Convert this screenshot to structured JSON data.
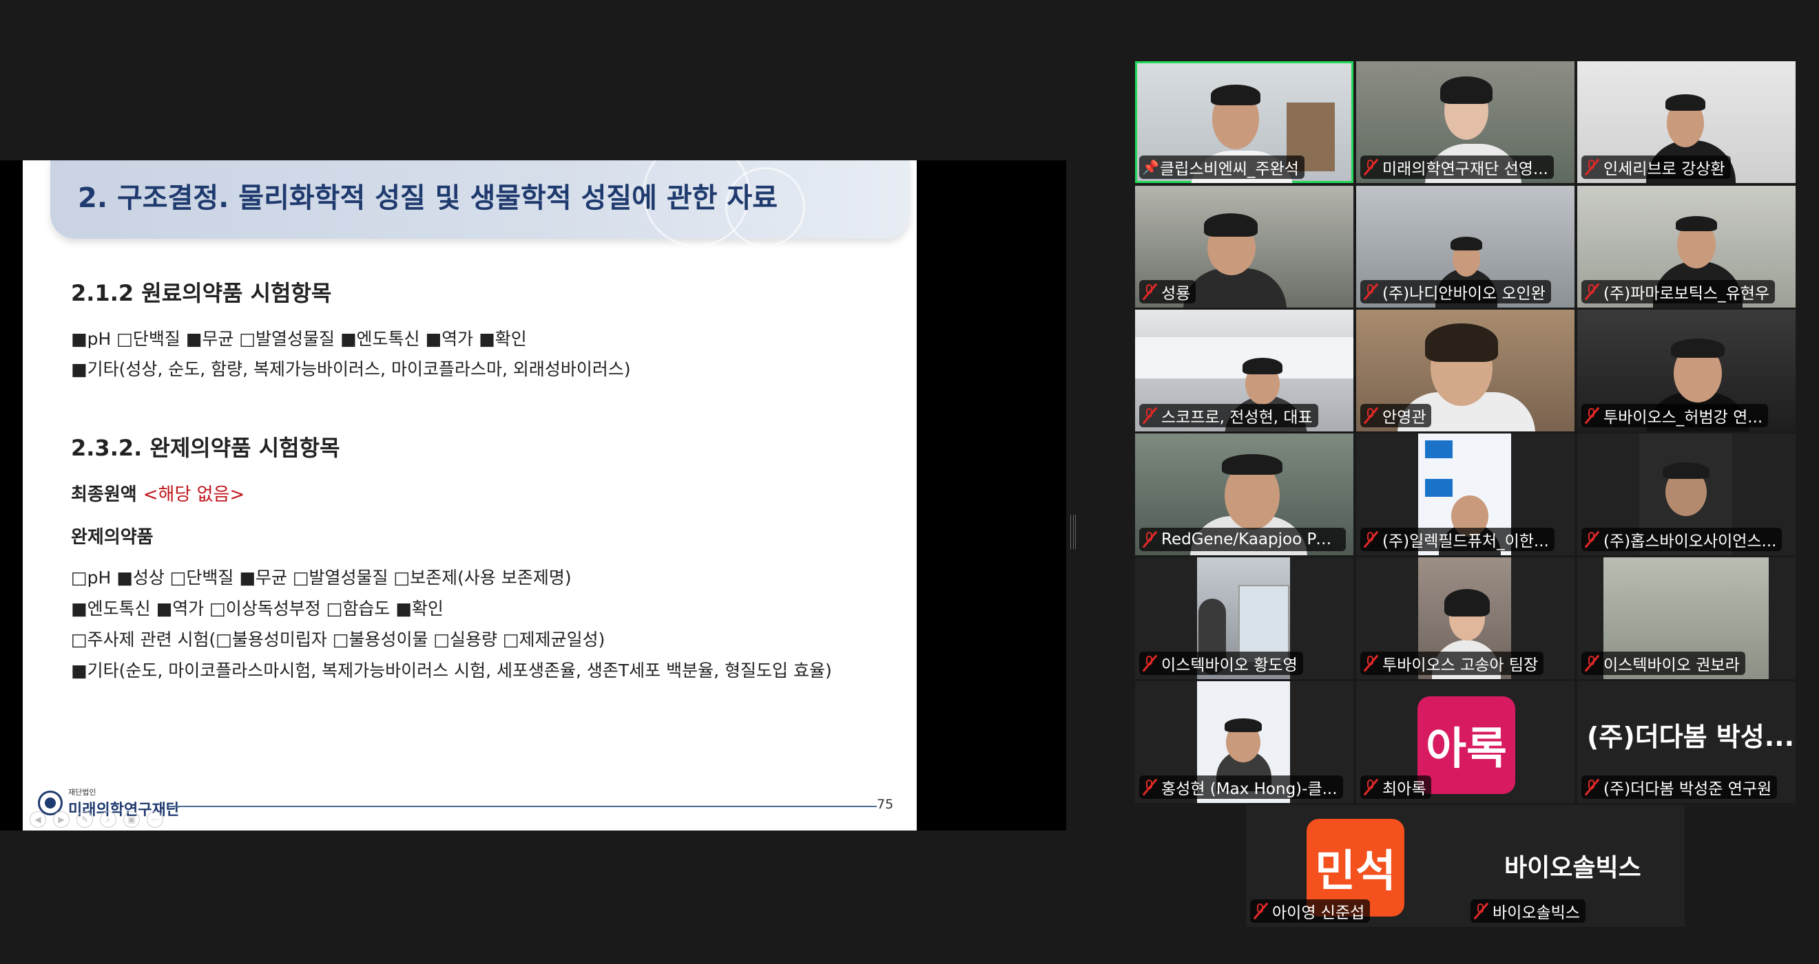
{
  "slide": {
    "title": "2. 구조결정. 물리화학적 성질 및 생물학적 성질에 관한 자료",
    "section1_heading": "2.1.2 원료의약품 시험항목",
    "section1_line1": "■pH  □단백질  ■무균  □발열성물질  ■엔도톡신  ■역가  ■확인",
    "section1_line2": "■기타(성상, 순도, 함량, 복제가능바이러스, 마이코플라스마, 외래성바이러스)",
    "section2_heading": "2.3.2. 완제의약품 시험항목",
    "final_bulk_label": "최종원액",
    "final_bulk_note": "<해당 없음>",
    "finished_product_label": "완제의약품",
    "finished_line1": "□pH  ■성상  □단백질  ■무균  □발열성물질  □보존제(사용 보존제명)",
    "finished_line2": "■엔도톡신  ■역가  □이상독성부정  □함습도  ■확인",
    "finished_line3": "□주사제 관련 시험(□불용성미립자 □불용성이물 □실용량 □제제균일성)",
    "finished_line4": "■기타(순도, 마이코플라스마시험, 복제가능바이러스 시험, 세포생존율, 생존T세포 백분율, 형질도입 효율)",
    "page_number": "75",
    "logo_small": "재단법인",
    "logo_name": "미래의학연구재단"
  },
  "participants": [
    {
      "name": "클립스비엔씨_주완석",
      "muted": false,
      "pinned": true,
      "active": true
    },
    {
      "name": "미래의학연구재단 선영...",
      "muted": true
    },
    {
      "name": "인세리브로 강상환",
      "muted": true
    },
    {
      "name": "성룡",
      "muted": true
    },
    {
      "name": "(주)나디안바이오 오인완",
      "muted": true
    },
    {
      "name": "(주)파마로보틱스_유현우",
      "muted": true
    },
    {
      "name": "스코프로, 전성현, 대표",
      "muted": true
    },
    {
      "name": "안영관",
      "muted": true
    },
    {
      "name": "투바이오스_허범강 연...",
      "muted": true
    },
    {
      "name": "RedGene/Kaapjoo Park",
      "muted": true
    },
    {
      "name": "(주)일렉필드퓨처_이한...",
      "muted": true
    },
    {
      "name": "(주)홉스바이오사이언스...",
      "muted": true
    },
    {
      "name": "이스텍바이오 황도영",
      "muted": true
    },
    {
      "name": "투바이오스 고송아 팀장",
      "muted": true
    },
    {
      "name": "이스텍바이오 권보라",
      "muted": true
    },
    {
      "name": "홍성현 (Max Hong)-클...",
      "muted": true
    },
    {
      "name": "최아록",
      "muted": true,
      "avatar_text": "아록",
      "avatar_color": "#d81b60"
    },
    {
      "name": "(주)더다봄 박성준 연구원",
      "muted": true,
      "display_name": "(주)더다봄 박성..."
    },
    {
      "name": "아이영 신준섭",
      "muted": true,
      "avatar_text": "민석",
      "avatar_color": "#f4511e"
    },
    {
      "name": "바이오솔빅스",
      "muted": true,
      "display_name": "바이오솔빅스"
    }
  ],
  "colors": {
    "background": "#1a1a1a",
    "active_speaker": "#23d959",
    "muted_icon": "#e02828",
    "title_blue": "#1f3a6e"
  }
}
